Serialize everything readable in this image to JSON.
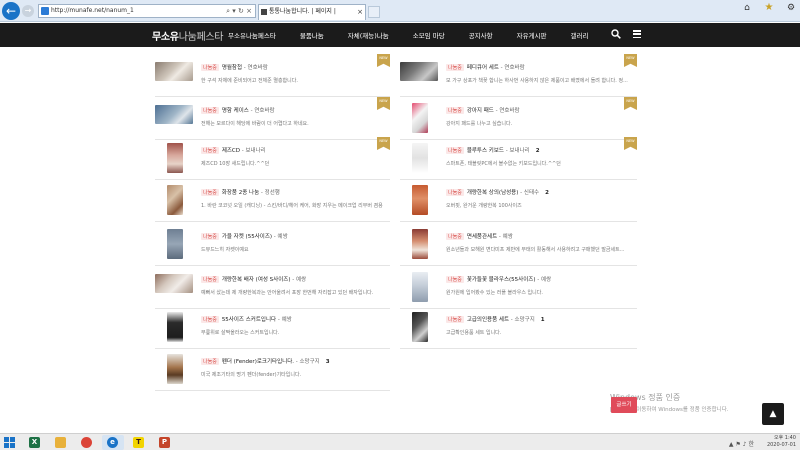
{
  "browser": {
    "address": "http://munafe.net/nanum_1",
    "tab_title": "통통나눔합니다. | 페이지 |",
    "tab_close": "×",
    "back": "←",
    "forward": "→",
    "addr_tools": "⌕ ▾ ↻ ×",
    "controls": [
      "⌂",
      "★",
      "⚙"
    ]
  },
  "site": {
    "logo_main": "무소유",
    "logo_accent": "나눔페스타",
    "menu": [
      "무소유나눔페스타",
      "물품나눔",
      "자체(재능)나눔",
      "소모임 마당",
      "공지사항",
      "자유게시판",
      "갤러리"
    ]
  },
  "left_cards": [
    {
      "tag": "나눔중",
      "title": "명월참첩",
      "author": " - 연호바람",
      "desc": "한 구석 자체에 준비되어고 전체준 멸층합니다.",
      "ribbon": "NEW",
      "thumb": "gloves"
    },
    {
      "tag": "나눔중",
      "title": "명함 케이스",
      "author": " - 연호바람",
      "desc": "전해는 모르다이 해당에 바람이 더 어렵다고 하네요.",
      "ribbon": "NEW",
      "thumb": "case"
    },
    {
      "tag": "나눔중",
      "title": "제즈CD",
      "author": " - 보내나리",
      "desc": "제즈CD 10장 새드립니다.^^던",
      "ribbon": "NEW",
      "thumb": "cd"
    },
    {
      "tag": "나눔중",
      "title": "화장품 2종 나눔",
      "author": " - 정선행",
      "desc": "1. 바란 코코넛 오일 (캐디닝) - 스킨/바디/헤어 케어, 화장 지우는 메이크업 리무버 겸용",
      "ribbon": "",
      "thumb": "cosmetic"
    },
    {
      "tag": "나눔중",
      "title": "가을 자켓 (55사이즈)",
      "author": " - 예쌍",
      "desc": "드뷰드느히 자켓이예요",
      "ribbon": "",
      "thumb": "jacket"
    },
    {
      "tag": "나눔중",
      "title": "개량한복 배자 (여성 S사이즈)",
      "author": " - 예쌍",
      "desc": "예뻐서 샀는데 제 개량한복과는 안어울려서 포장 한번해 자리잡고 있던 배자입니다.",
      "ribbon": "",
      "thumb": "vest"
    },
    {
      "tag": "나눔중",
      "title": "55사이즈 스커트입니다",
      "author": " - 예쌍",
      "desc": "무릎위로 살짝올라오는 스커트입니다.",
      "ribbon": "",
      "thumb": "skirt"
    },
    {
      "tag": "나눔중",
      "title": "펜더 (Fender)로크기타입니다.",
      "author": " - 소망구지",
      "count": "3",
      "desc": "미국 제조기타의 명기 펜더(fender)기타입니다.",
      "ribbon": "",
      "thumb": "guitar"
    }
  ],
  "right_cards": [
    {
      "tag": "나눔중",
      "title": "페디큐어 세트",
      "author": " - 연호바람",
      "desc": "모 가구 상포가 책꽂 합니는 하사번 사용하지 않은 제품이고 배꼈에서 돌려 합니다. 정...",
      "ribbon": "NEW",
      "thumb": "pedicure"
    },
    {
      "tag": "나눔중",
      "title": "강아지 패드",
      "author": " - 연호바람",
      "desc": "강아지 패드를 나누고 싶습니다.",
      "ribbon": "NEW",
      "thumb": "pad"
    },
    {
      "tag": "나눔중",
      "title": "블루투스 키보드",
      "author": " - 보내나리",
      "count": "2",
      "desc": "스마트폰, 태블릿PC에서 블수없는 키보드입니다.^^던",
      "ribbon": "NEW",
      "thumb": "keyboard"
    },
    {
      "tag": "나눔중",
      "title": "개량한복 상의(남성용)",
      "author": " - 신태수",
      "count": "2",
      "desc": "오버핏, 완거운 개량한복 100사이즈",
      "ribbon": "",
      "thumb": "hanbok"
    },
    {
      "tag": "나눔중",
      "title": "면세품관세트",
      "author": " - 예쌍",
      "desc": "원소년들과 모해원 변다미프 제반에 무태의 활동해서 사용하려고 구매했던 말금세트...",
      "ribbon": "",
      "thumb": "beauty"
    },
    {
      "tag": "나눔중",
      "title": "꽃가들꽃 블라우스(55사이즈)",
      "author": " - 예쌍",
      "desc": "원가원에 입어봤수 있는 러플 블라우스 입니다.",
      "ribbon": "",
      "thumb": "blouse"
    },
    {
      "tag": "나눔중",
      "title": "고급의인용품 세트",
      "author": " - 소망구지",
      "count": "1",
      "desc": "고급확인용품 세트 입니다.",
      "ribbon": "",
      "thumb": "watch"
    }
  ],
  "watermark": {
    "line1": "Windows 정품 인증",
    "line2": "[설정]으로 이동하여 Windows를 정품 인증합니다."
  },
  "fab_red_label": "글쓰기",
  "fab_top_label": "▲",
  "tray": {
    "time": "오후 1:40",
    "date": "2020-07-01",
    "icons": "▲ ⚑ ♪ 한"
  }
}
